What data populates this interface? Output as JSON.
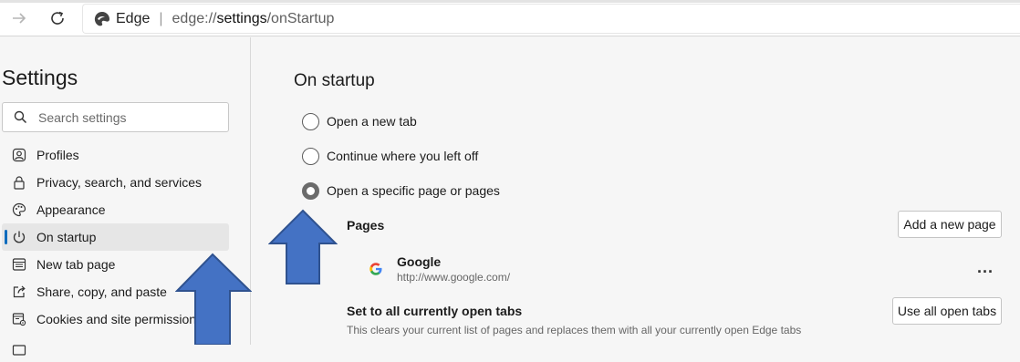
{
  "browser": {
    "brand": "Edge",
    "separator": "|",
    "url_prefix": "edge://",
    "url_bold": "settings",
    "url_suffix": "/onStartup"
  },
  "sidebar": {
    "title": "Settings",
    "search_placeholder": "Search settings",
    "items": [
      {
        "label": "Profiles",
        "icon": "profile-icon"
      },
      {
        "label": "Privacy, search, and services",
        "icon": "lock-icon"
      },
      {
        "label": "Appearance",
        "icon": "palette-icon"
      },
      {
        "label": "On startup",
        "icon": "power-icon",
        "active": true
      },
      {
        "label": "New tab page",
        "icon": "newtab-icon"
      },
      {
        "label": "Share, copy, and paste",
        "icon": "share-icon"
      },
      {
        "label": "Cookies and site permissions",
        "icon": "cookies-icon"
      }
    ]
  },
  "main": {
    "title": "On startup",
    "options": [
      {
        "label": "Open a new tab",
        "selected": false
      },
      {
        "label": "Continue where you left off",
        "selected": false
      },
      {
        "label": "Open a specific page or pages",
        "selected": true
      }
    ],
    "pages_label": "Pages",
    "add_page_button": "Add a new page",
    "pages": [
      {
        "name": "Google",
        "url": "http://www.google.com/"
      }
    ],
    "more_label": "...",
    "set_all_title": "Set to all currently open tabs",
    "set_all_desc": "This clears your current list of pages and replaces them with all your currently open Edge tabs",
    "use_all_button": "Use all open tabs"
  },
  "colors": {
    "accent": "#0f6cbd",
    "arrow": "#4472c4",
    "arrow_border": "#2f528f"
  }
}
